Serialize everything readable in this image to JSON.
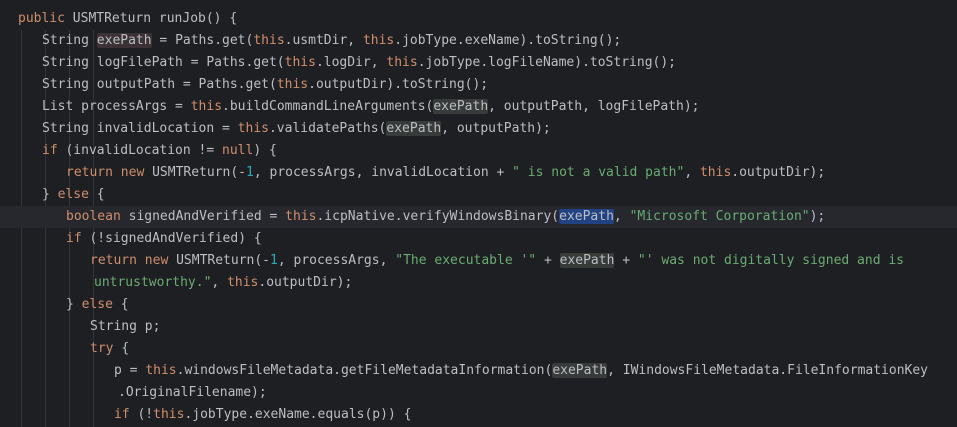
{
  "editor": {
    "lines": [
      {
        "indent": 0,
        "tokens": [
          {
            "c": "kw",
            "t": "public "
          },
          {
            "c": "plain",
            "t": "USMTReturn runJob() {"
          }
        ]
      },
      {
        "indent": 1,
        "tokens": [
          {
            "c": "plain",
            "t": "String "
          },
          {
            "c": "plain hl-warn",
            "t": "exePath"
          },
          {
            "c": "plain",
            "t": " = Paths.get("
          },
          {
            "c": "kw",
            "t": "this"
          },
          {
            "c": "plain",
            "t": ".usmtDir, "
          },
          {
            "c": "kw",
            "t": "this"
          },
          {
            "c": "plain",
            "t": ".jobType.exeName).toString();"
          }
        ]
      },
      {
        "indent": 1,
        "tokens": [
          {
            "c": "plain",
            "t": "String logFilePath = Paths.get("
          },
          {
            "c": "kw",
            "t": "this"
          },
          {
            "c": "plain",
            "t": ".logDir, "
          },
          {
            "c": "kw",
            "t": "this"
          },
          {
            "c": "plain",
            "t": ".jobType.logFileName).toString();"
          }
        ]
      },
      {
        "indent": 1,
        "tokens": [
          {
            "c": "plain",
            "t": "String outputPath = Paths.get("
          },
          {
            "c": "kw",
            "t": "this"
          },
          {
            "c": "plain",
            "t": ".outputDir).toString();"
          }
        ]
      },
      {
        "indent": 1,
        "tokens": [
          {
            "c": "plain",
            "t": "List processArgs = "
          },
          {
            "c": "kw",
            "t": "this"
          },
          {
            "c": "plain",
            "t": ".buildCommandLineArguments("
          },
          {
            "c": "plain hl",
            "t": "exePath"
          },
          {
            "c": "plain",
            "t": ", outputPath, logFilePath);"
          }
        ]
      },
      {
        "indent": 1,
        "tokens": [
          {
            "c": "plain",
            "t": "String invalidLocation = "
          },
          {
            "c": "kw",
            "t": "this"
          },
          {
            "c": "plain",
            "t": ".validatePaths("
          },
          {
            "c": "plain hl",
            "t": "exePath"
          },
          {
            "c": "plain",
            "t": ", outputPath);"
          }
        ]
      },
      {
        "indent": 1,
        "tokens": [
          {
            "c": "kw",
            "t": "if "
          },
          {
            "c": "plain",
            "t": "(invalidLocation != "
          },
          {
            "c": "kw",
            "t": "null"
          },
          {
            "c": "plain",
            "t": ") {"
          }
        ]
      },
      {
        "indent": 2,
        "tokens": [
          {
            "c": "kw",
            "t": "return new "
          },
          {
            "c": "plain",
            "t": "USMTReturn(-"
          },
          {
            "c": "num",
            "t": "1"
          },
          {
            "c": "plain",
            "t": ", processArgs, invalidLocation + "
          },
          {
            "c": "str",
            "t": "\" is not a valid path\""
          },
          {
            "c": "plain",
            "t": ", "
          },
          {
            "c": "kw",
            "t": "this"
          },
          {
            "c": "plain",
            "t": ".outputDir);"
          }
        ]
      },
      {
        "indent": 1,
        "tokens": [
          {
            "c": "plain",
            "t": "} "
          },
          {
            "c": "kw",
            "t": "else "
          },
          {
            "c": "plain",
            "t": "{"
          }
        ]
      },
      {
        "indent": 2,
        "current": true,
        "tokens": [
          {
            "c": "kw",
            "t": "boolean "
          },
          {
            "c": "plain",
            "t": "signedAndVerified = "
          },
          {
            "c": "kw",
            "t": "this"
          },
          {
            "c": "plain",
            "t": ".icpNative.verifyWindowsBinary("
          },
          {
            "c": "plain hl-sel",
            "t": "exePath"
          },
          {
            "c": "plain",
            "t": ", "
          },
          {
            "c": "str",
            "t": "\"Microsoft Corporation\""
          },
          {
            "c": "plain",
            "t": ");"
          }
        ]
      },
      {
        "indent": 2,
        "tokens": [
          {
            "c": "kw",
            "t": "if "
          },
          {
            "c": "plain",
            "t": "(!signedAndVerified) {"
          }
        ]
      },
      {
        "indent": 3,
        "tokens": [
          {
            "c": "kw",
            "t": "return new "
          },
          {
            "c": "plain",
            "t": "USMTReturn(-"
          },
          {
            "c": "num",
            "t": "1"
          },
          {
            "c": "plain",
            "t": ", processArgs, "
          },
          {
            "c": "str",
            "t": "\"The executable '\""
          },
          {
            "c": "plain",
            "t": " + "
          },
          {
            "c": "plain hl",
            "t": "exePath"
          },
          {
            "c": "plain",
            "t": " + "
          },
          {
            "c": "str",
            "t": "\"' was not digitally signed and is"
          }
        ]
      },
      {
        "indent": 3,
        "cont": true,
        "tokens": [
          {
            "c": "str",
            "t": "untrustworthy.\""
          },
          {
            "c": "plain",
            "t": ", "
          },
          {
            "c": "kw",
            "t": "this"
          },
          {
            "c": "plain",
            "t": ".outputDir);"
          }
        ]
      },
      {
        "indent": 2,
        "tokens": [
          {
            "c": "plain",
            "t": "} "
          },
          {
            "c": "kw",
            "t": "else "
          },
          {
            "c": "plain",
            "t": "{"
          }
        ]
      },
      {
        "indent": 3,
        "tokens": [
          {
            "c": "plain",
            "t": "String p;"
          }
        ]
      },
      {
        "indent": 3,
        "tokens": [
          {
            "c": "kw",
            "t": "try "
          },
          {
            "c": "plain",
            "t": "{"
          }
        ]
      },
      {
        "indent": 4,
        "tokens": [
          {
            "c": "plain",
            "t": "p = "
          },
          {
            "c": "kw",
            "t": "this"
          },
          {
            "c": "plain",
            "t": ".windowsFileMetadata.getFileMetadataInformation("
          },
          {
            "c": "plain hl",
            "t": "exePath"
          },
          {
            "c": "plain",
            "t": ", IWindowsFileMetadata.FileInformationKey"
          }
        ]
      },
      {
        "indent": 4,
        "cont": true,
        "tokens": [
          {
            "c": "plain",
            "t": ".OriginalFilename);"
          }
        ]
      },
      {
        "indent": 4,
        "tokens": [
          {
            "c": "kw",
            "t": "if "
          },
          {
            "c": "plain",
            "t": "(!"
          },
          {
            "c": "kw",
            "t": "this"
          },
          {
            "c": "plain",
            "t": ".jobType.exeName.equals(p)) {"
          }
        ]
      }
    ]
  }
}
